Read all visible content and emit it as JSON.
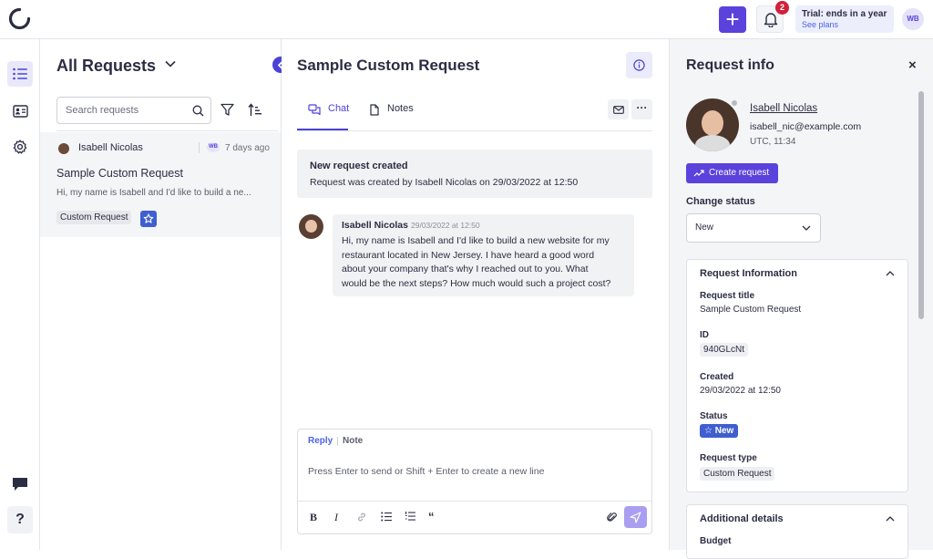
{
  "topbar": {
    "notifications_count": "2",
    "trial_title": "Trial: ends in a year",
    "trial_link": "See plans",
    "user_initials": "WB"
  },
  "list": {
    "title": "All Requests",
    "search_placeholder": "Search requests",
    "items": [
      {
        "author": "Isabell Nicolas",
        "assignee_initials": "WB",
        "time": "7 days ago",
        "title": "Sample Custom Request",
        "preview": "Hi, my name is Isabell and I'd like to build a ne...",
        "tag": "Custom Request"
      }
    ]
  },
  "conversation": {
    "title": "Sample Custom Request",
    "tabs": [
      {
        "label": "Chat"
      },
      {
        "label": "Notes"
      }
    ],
    "system_message": {
      "title": "New request created",
      "text": "Request was created by Isabell Nicolas on 29/03/2022 at 12:50"
    },
    "message": {
      "author": "Isabell Nicolas",
      "time": "29/03/2022 at 12:50",
      "lines": [
        "Hi, my name is Isabell and I'd like to build a new website for my",
        "restaurant located in New Jersey. I have heard a good word",
        "about your company that's why I reached out to you. What",
        "would be the next steps? How much would such a project cost?"
      ]
    },
    "composer": {
      "reply_tab": "Reply",
      "note_tab": "Note",
      "placeholder": "Press Enter to send or Shift + Enter to create a new line"
    }
  },
  "info": {
    "title": "Request info",
    "contact": {
      "name": "Isabell Nicolas",
      "email": "isabell_nic@example.com",
      "timezone": "UTC, 11:34"
    },
    "create_request_label": "Create request",
    "change_status_label": "Change status",
    "status_value": "New",
    "request_information": {
      "heading": "Request Information",
      "title_label": "Request title",
      "title_value": "Sample Custom Request",
      "id_label": "ID",
      "id_value": "940GLcNt",
      "created_label": "Created",
      "created_value": "29/03/2022 at 12:50",
      "status_label": "Status",
      "status_value": "New",
      "type_label": "Request type",
      "type_value": "Custom Request"
    },
    "additional": {
      "heading": "Additional details",
      "budget_label": "Budget"
    }
  },
  "colors": {
    "accent": "#5b42dc",
    "badge_red": "#d0213a",
    "link_blue": "#4b63e0",
    "status_blue": "#3f5ed0"
  }
}
